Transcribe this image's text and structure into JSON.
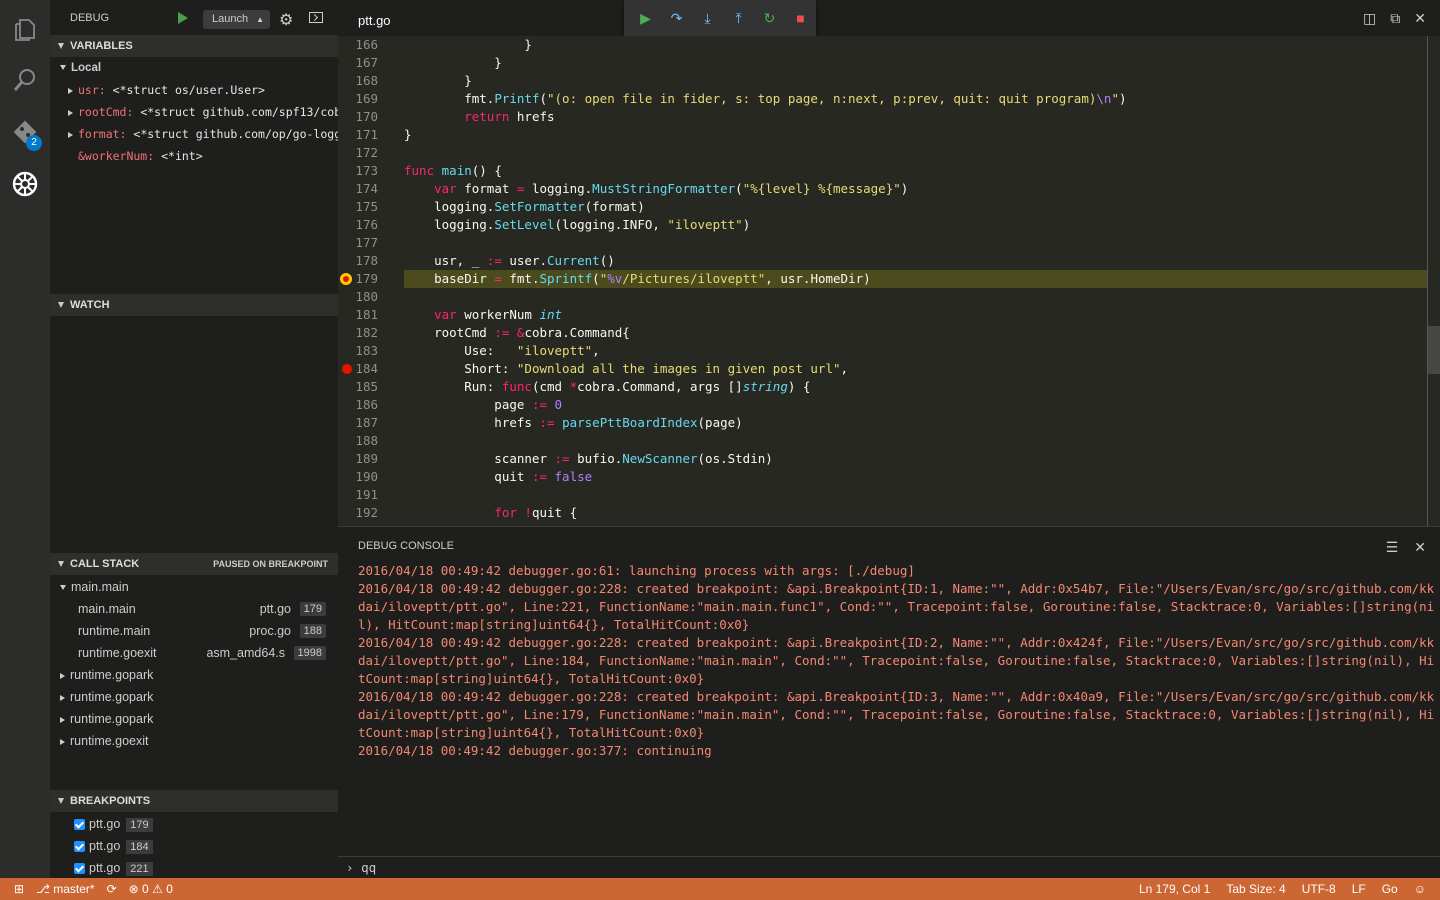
{
  "sidebar": {
    "title": "DEBUG",
    "launch_label": "Launch",
    "variables_header": "VARIABLES",
    "local_label": "Local",
    "variables": [
      {
        "name": "usr:",
        "value": "<*struct os/user.User>"
      },
      {
        "name": "rootCmd:",
        "value": "<*struct github.com/spf13/cob..."
      },
      {
        "name": "format:",
        "value": "<*struct github.com/op/go-logg..."
      },
      {
        "name": "&workerNum:",
        "value": "<*int>"
      }
    ],
    "watch_header": "WATCH",
    "callstack_header": "CALL STACK",
    "callstack_status": "PAUSED ON BREAKPOINT",
    "thread": "main.main",
    "frames": [
      {
        "name": "main.main",
        "file": "ptt.go",
        "line": "179"
      },
      {
        "name": "runtime.main",
        "file": "proc.go",
        "line": "188"
      },
      {
        "name": "runtime.goexit",
        "file": "asm_amd64.s",
        "line": "1998"
      }
    ],
    "other_threads": [
      "runtime.gopark",
      "runtime.gopark",
      "runtime.gopark",
      "runtime.goexit"
    ],
    "breakpoints_header": "BREAKPOINTS",
    "breakpoints": [
      {
        "file": "ptt.go",
        "line": "179"
      },
      {
        "file": "ptt.go",
        "line": "184"
      },
      {
        "file": "ptt.go",
        "line": "221"
      }
    ]
  },
  "activity": {
    "git_badge": "2"
  },
  "editor": {
    "tab": "ptt.go",
    "line_numbers": [
      "166",
      "167",
      "168",
      "169",
      "170",
      "171",
      "172",
      "173",
      "174",
      "175",
      "176",
      "177",
      "178",
      "179",
      "180",
      "181",
      "182",
      "183",
      "184",
      "185",
      "186",
      "187",
      "188",
      "189",
      "190",
      "191",
      "192"
    ]
  },
  "console": {
    "title": "DEBUG CONSOLE",
    "output": "2016/04/18 00:49:42 debugger.go:61: launching process with args: [./debug]\n2016/04/18 00:49:42 debugger.go:228: created breakpoint: &api.Breakpoint{ID:1, Name:\"\", Addr:0x54b7, File:\"/Users/Evan/src/go/src/github.com/kkdai/iloveptt/ptt.go\", Line:221, FunctionName:\"main.main.func1\", Cond:\"\", Tracepoint:false, Goroutine:false, Stacktrace:0, Variables:[]string(nil), HitCount:map[string]uint64{}, TotalHitCount:0x0}\n2016/04/18 00:49:42 debugger.go:228: created breakpoint: &api.Breakpoint{ID:2, Name:\"\", Addr:0x424f, File:\"/Users/Evan/src/go/src/github.com/kkdai/iloveptt/ptt.go\", Line:184, FunctionName:\"main.main\", Cond:\"\", Tracepoint:false, Goroutine:false, Stacktrace:0, Variables:[]string(nil), HitCount:map[string]uint64{}, TotalHitCount:0x0}\n2016/04/18 00:49:42 debugger.go:228: created breakpoint: &api.Breakpoint{ID:3, Name:\"\", Addr:0x40a9, File:\"/Users/Evan/src/go/src/github.com/kkdai/iloveptt/ptt.go\", Line:179, FunctionName:\"main.main\", Cond:\"\", Tracepoint:false, Goroutine:false, Stacktrace:0, Variables:[]string(nil), HitCount:map[string]uint64{}, TotalHitCount:0x0}\n2016/04/18 00:49:42 debugger.go:377: continuing",
    "input": "qq"
  },
  "statusbar": {
    "branch": "master*",
    "errors": "0",
    "warnings": "0",
    "position": "Ln 179, Col 1",
    "tab_size": "Tab Size: 4",
    "encoding": "UTF-8",
    "eol": "LF",
    "language": "Go"
  }
}
